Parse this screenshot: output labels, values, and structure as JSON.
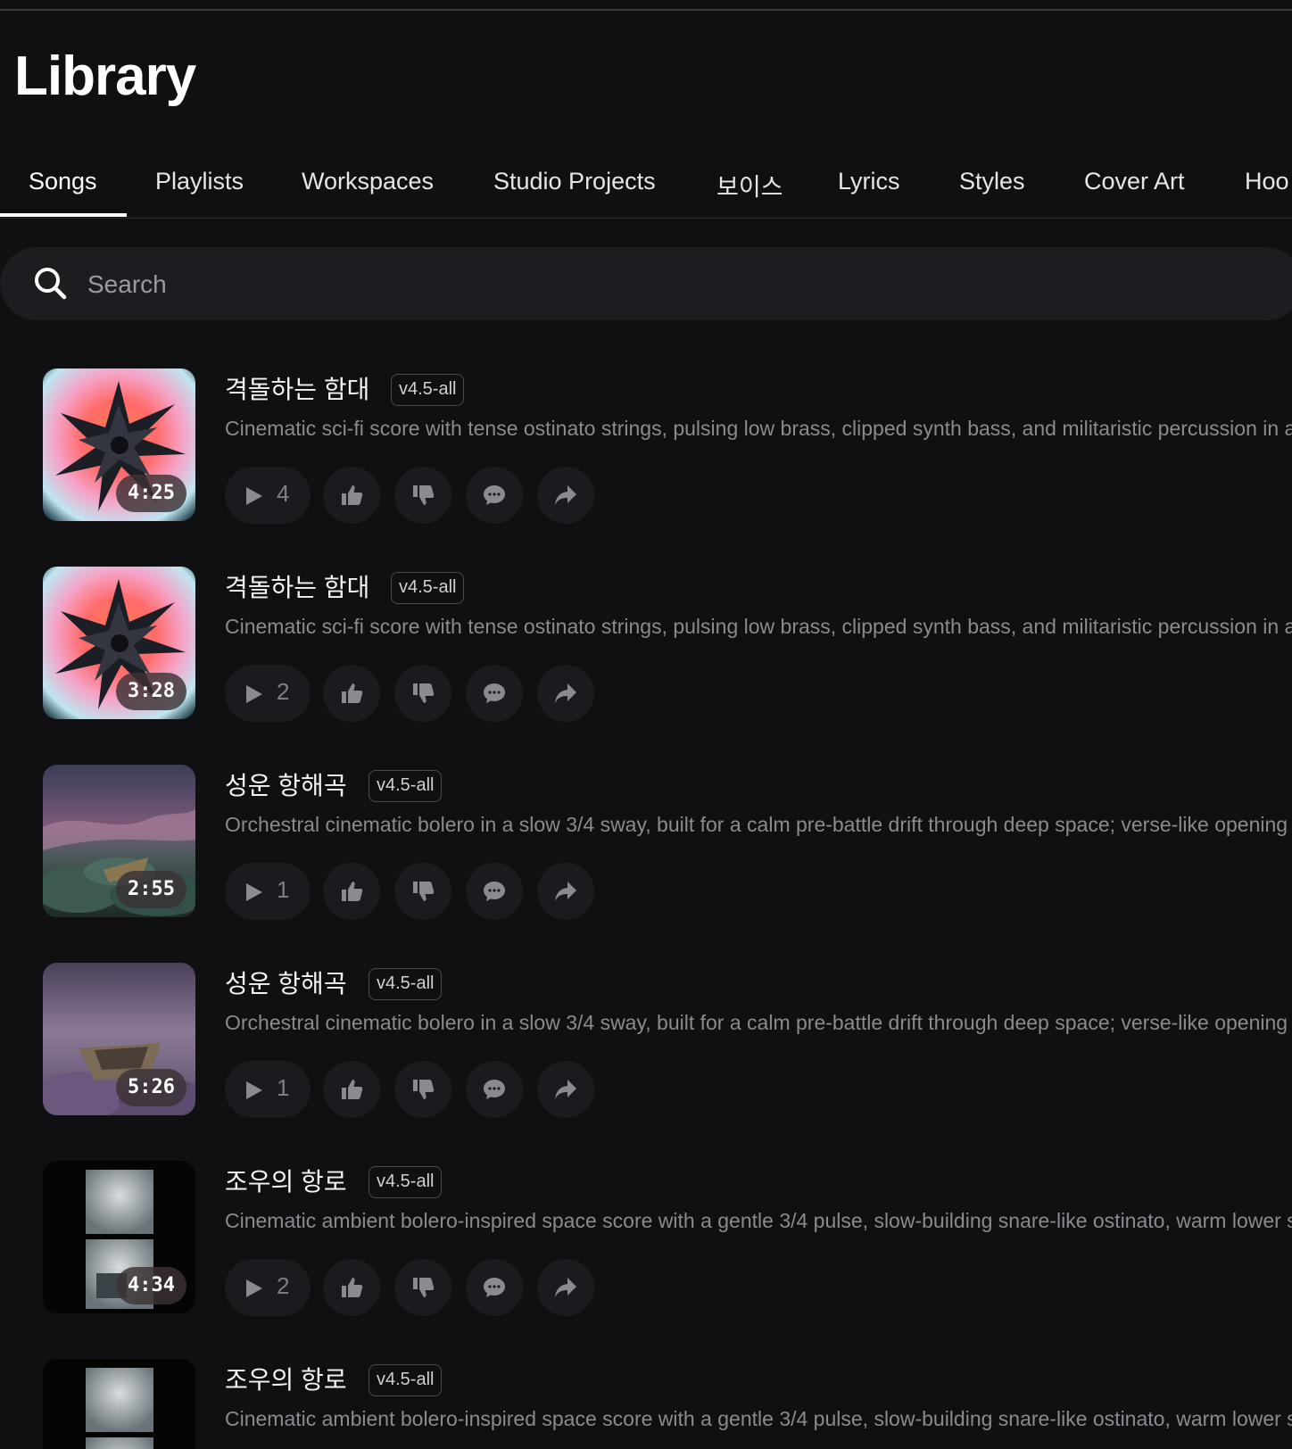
{
  "header": {
    "title": "Library"
  },
  "tabs": [
    {
      "label": "Songs",
      "active": true
    },
    {
      "label": "Playlists"
    },
    {
      "label": "Workspaces"
    },
    {
      "label": "Studio Projects"
    },
    {
      "label": "보이스"
    },
    {
      "label": "Lyrics"
    },
    {
      "label": "Styles"
    },
    {
      "label": "Cover Art"
    },
    {
      "label": "Hoo"
    }
  ],
  "search": {
    "placeholder": "Search",
    "icon": "search-icon"
  },
  "songs": [
    {
      "title": "격돌하는 함대",
      "version": "v4.5-all",
      "description": "Cinematic sci-fi score with tense ostinato strings, pulsing low brass, clipped synth bass, and militaristic percussion in a",
      "duration": "4:25",
      "plays": "4",
      "cover": "starburst"
    },
    {
      "title": "격돌하는 함대",
      "version": "v4.5-all",
      "description": "Cinematic sci-fi score with tense ostinato strings, pulsing low brass, clipped synth bass, and militaristic percussion in a",
      "duration": "3:28",
      "plays": "2",
      "cover": "starburst"
    },
    {
      "title": "성운 항해곡",
      "version": "v4.5-all",
      "description": "Orchestral cinematic bolero in a slow 3/4 sway, built for a calm pre-battle drift through deep space; verse-like opening",
      "duration": "2:55",
      "plays": "1",
      "cover": "nebula"
    },
    {
      "title": "성운 항해곡",
      "version": "v4.5-all",
      "description": "Orchestral cinematic bolero in a slow 3/4 sway, built for a calm pre-battle drift through deep space; verse-like opening",
      "duration": "5:26",
      "plays": "1",
      "cover": "boat"
    },
    {
      "title": "조우의 항로",
      "version": "v4.5-all",
      "description": "Cinematic ambient bolero-inspired space score with a gentle 3/4 pulse, slow-building snare-like ostinato, warm lower s",
      "duration": "4:34",
      "plays": "2",
      "cover": "frames"
    },
    {
      "title": "조우의 항로",
      "version": "v4.5-all",
      "description": "Cinematic ambient bolero-inspired space score with a gentle 3/4 pulse, slow-building snare-like ostinato, warm lower s",
      "duration": "",
      "plays": "",
      "cover": "frames"
    }
  ],
  "colors": {
    "background": "#101012",
    "button_bg": "#1b1b1f",
    "icon": "#8a8a90",
    "badge_border": "#4a4a50"
  }
}
